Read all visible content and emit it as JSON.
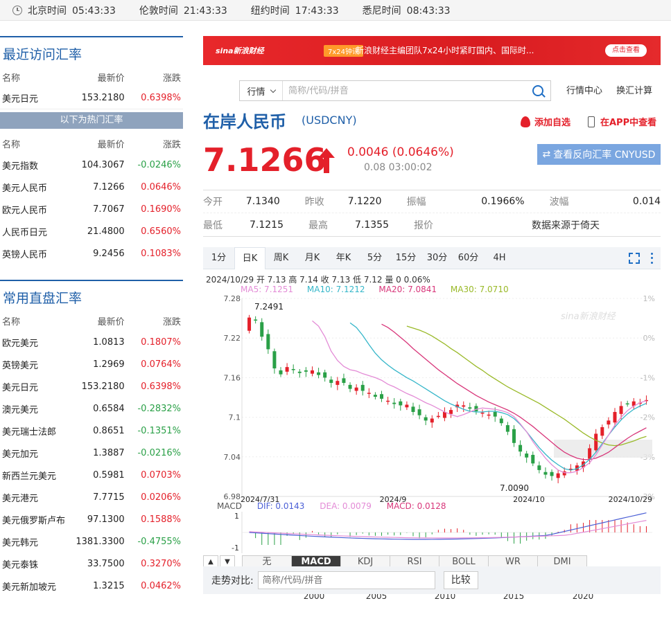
{
  "clock": [
    {
      "city": "北京时间",
      "time": "05:43:33"
    },
    {
      "city": "伦敦时间",
      "time": "21:43:33"
    },
    {
      "city": "纽约时间",
      "time": "17:43:33"
    },
    {
      "city": "悉尼时间",
      "time": "08:43:33"
    }
  ],
  "recent": {
    "title": "最近访问汇率",
    "headers": [
      "名称",
      "最新价",
      "涨跌"
    ],
    "rows": [
      {
        "name": "美元日元",
        "price": "153.2180",
        "chg": "0.6398%",
        "dir": "up"
      }
    ],
    "hot_banner": "以下为热门汇率",
    "hot_headers": [
      "名称",
      "最新价",
      "涨跌"
    ],
    "hot_rows": [
      {
        "name": "美元指数",
        "price": "104.3067",
        "chg": "-0.0246%",
        "dir": "dn"
      },
      {
        "name": "美元人民币",
        "price": "7.1266",
        "chg": "0.0646%",
        "dir": "up"
      },
      {
        "name": "欧元人民币",
        "price": "7.7067",
        "chg": "0.1690%",
        "dir": "up"
      },
      {
        "name": "人民币日元",
        "price": "21.4800",
        "chg": "0.6560%",
        "dir": "up"
      },
      {
        "name": "英镑人民币",
        "price": "9.2456",
        "chg": "0.1083%",
        "dir": "up"
      }
    ]
  },
  "direct": {
    "title": "常用直盘汇率",
    "headers": [
      "名称",
      "最新价",
      "涨跌"
    ],
    "rows": [
      {
        "name": "欧元美元",
        "price": "1.0813",
        "chg": "0.1807%",
        "dir": "up"
      },
      {
        "name": "英镑美元",
        "price": "1.2969",
        "chg": "0.0764%",
        "dir": "up"
      },
      {
        "name": "美元日元",
        "price": "153.2180",
        "chg": "0.6398%",
        "dir": "up"
      },
      {
        "name": "澳元美元",
        "price": "0.6584",
        "chg": "-0.2832%",
        "dir": "dn"
      },
      {
        "name": "美元瑞士法郎",
        "price": "0.8651",
        "chg": "-0.1351%",
        "dir": "dn"
      },
      {
        "name": "美元加元",
        "price": "1.3887",
        "chg": "-0.0216%",
        "dir": "dn"
      },
      {
        "name": "新西兰元美元",
        "price": "0.5981",
        "chg": "0.0703%",
        "dir": "up"
      },
      {
        "name": "美元港元",
        "price": "7.7715",
        "chg": "0.0206%",
        "dir": "up"
      },
      {
        "name": "美元俄罗斯卢布",
        "price": "97.1300",
        "chg": "0.1588%",
        "dir": "up"
      },
      {
        "name": "美元韩元",
        "price": "1381.3300",
        "chg": "-0.4755%",
        "dir": "dn"
      },
      {
        "name": "美元泰铢",
        "price": "33.7500",
        "chg": "0.3270%",
        "dir": "up"
      },
      {
        "name": "美元新加坡元",
        "price": "1.3215",
        "chg": "0.0462%",
        "dir": "up"
      }
    ]
  },
  "ad": {
    "logo": "sina新浪财经",
    "tag": "7x24钟讯",
    "text": "新浪财经主编团队7x24小时紧盯国内、国际时...",
    "button": "点击查看"
  },
  "search": {
    "select": "行情",
    "placeholder": "简称/代码/拼音",
    "link1": "行情中心",
    "link2": "换汇计算"
  },
  "header": {
    "title": "在岸人民币",
    "code": "(USDCNY)",
    "fav": "添加自选",
    "app": "在APP中查看"
  },
  "quote": {
    "price": "7.1266",
    "change": "0.0046 (0.0646%)",
    "time": "0.08 03:00:02",
    "reverse": "查看反向汇率 CNYUSD"
  },
  "stats": {
    "open_l": "今开",
    "open": "7.1340",
    "prev_l": "昨收",
    "prev": "7.1220",
    "amp_l": "振幅",
    "amp": "0.1966%",
    "wave_l": "波幅",
    "wave": "0.014",
    "low_l": "最低",
    "low": "7.1215",
    "high_l": "最高",
    "high": "7.1355",
    "quote_l": "报价",
    "source": "数据来源于倚天"
  },
  "tabs": [
    "1分",
    "日K",
    "周K",
    "月K",
    "年K",
    "5分",
    "15分",
    "30分",
    "60分",
    "4H"
  ],
  "active_tab": 1,
  "ohlc": "2024/10/29 开 7.13 高 7.14 收 7.13 低 7.12 量 0 0.06%",
  "ma": {
    "ma5": "MA5: 7.1251",
    "ma10": "MA10: 7.1212",
    "ma20": "MA20: 7.0841",
    "ma30": "MA30: 7.0710"
  },
  "macd": {
    "label": "MACD",
    "dif": "DIF: 0.0143",
    "dea": "DEA: 0.0079",
    "macd": "MACD: 0.0128",
    "y_top": "1",
    "y_bot": "-1"
  },
  "indicators": [
    "无",
    "MACD",
    "KDJ",
    "RSI",
    "BOLL",
    "WR",
    "DMI"
  ],
  "active_indicator": 1,
  "range_years": [
    "2000",
    "2005",
    "2010",
    "2015",
    "2020"
  ],
  "compare": {
    "label": "走势对比:",
    "placeholder": "简称/代码/拼音",
    "button": "比较"
  },
  "colors": {
    "up": "#e4202a",
    "down": "#2aa047",
    "brand": "#1f5fa8"
  },
  "chart_data": {
    "type": "candlestick",
    "ylim": [
      6.98,
      7.28
    ],
    "y_ticks": [
      "7.28",
      "7.22",
      "7.16",
      "7.1",
      "7.04",
      "6.98"
    ],
    "pct_ticks": [
      "1%",
      "0%",
      "-1%",
      "-2%",
      "-3%",
      "-3%"
    ],
    "x_labels": [
      "2024/7/31",
      "2024/9",
      "2024/10",
      "2024/10/29"
    ],
    "max_label": "7.2491",
    "min_label": "7.0090",
    "close": [
      7.251,
      7.247,
      7.222,
      7.203,
      7.174,
      7.165,
      7.176,
      7.172,
      7.167,
      7.169,
      7.171,
      7.164,
      7.16,
      7.152,
      7.155,
      7.152,
      7.143,
      7.145,
      7.14,
      7.137,
      7.131,
      7.128,
      7.125,
      7.12,
      7.118,
      7.119,
      7.108,
      7.103,
      7.095,
      7.098,
      7.102,
      7.108,
      7.111,
      7.119,
      7.118,
      7.113,
      7.109,
      7.107,
      7.104,
      7.101,
      7.091,
      7.078,
      7.061,
      7.048,
      7.039,
      7.03,
      7.02,
      7.013,
      7.011,
      7.015,
      7.018,
      7.022,
      7.027,
      7.033,
      7.053,
      7.075,
      7.085,
      7.095,
      7.108,
      7.117,
      7.12,
      7.124,
      7.122,
      7.126
    ],
    "ma5": [
      7.246,
      7.238,
      7.222,
      7.2,
      7.186,
      7.177,
      7.172,
      7.17,
      7.166,
      7.163,
      7.16,
      7.156,
      7.15,
      7.146,
      7.141,
      7.136,
      7.132,
      7.127,
      7.122,
      7.118,
      7.113,
      7.108,
      7.104,
      7.101,
      7.104,
      7.108,
      7.112,
      7.114,
      7.113,
      7.112,
      7.11,
      7.107,
      7.101,
      7.09,
      7.078,
      7.063,
      7.05,
      7.038,
      7.028,
      7.02,
      7.016,
      7.016,
      7.018,
      7.024,
      7.031,
      7.043,
      7.058,
      7.073,
      7.088,
      7.1,
      7.11,
      7.117,
      7.122,
      7.125
    ],
    "ma10": [
      7.243,
      7.236,
      7.224,
      7.21,
      7.197,
      7.187,
      7.179,
      7.172,
      7.166,
      7.16,
      7.155,
      7.149,
      7.143,
      7.137,
      7.131,
      7.125,
      7.12,
      7.116,
      7.112,
      7.109,
      7.108,
      7.108,
      7.109,
      7.109,
      7.107,
      7.104,
      7.098,
      7.089,
      7.078,
      7.066,
      7.054,
      7.044,
      7.035,
      7.028,
      7.022,
      7.02,
      7.022,
      7.028,
      7.036,
      7.047,
      7.06,
      7.073,
      7.085,
      7.096,
      7.105,
      7.112,
      7.117,
      7.121
    ],
    "ma20": [
      7.241,
      7.236,
      7.229,
      7.221,
      7.213,
      7.204,
      7.196,
      7.188,
      7.18,
      7.172,
      7.165,
      7.158,
      7.151,
      7.145,
      7.139,
      7.133,
      7.128,
      7.123,
      7.119,
      7.115,
      7.111,
      7.106,
      7.1,
      7.093,
      7.086,
      7.078,
      7.07,
      7.062,
      7.054,
      7.047,
      7.042,
      7.038,
      7.036,
      7.036,
      7.038,
      7.042,
      7.047,
      7.054,
      7.061,
      7.068,
      7.074,
      7.079,
      7.084
    ],
    "ma30": [
      7.238,
      7.235,
      7.232,
      7.228,
      7.223,
      7.217,
      7.211,
      7.204,
      7.198,
      7.191,
      7.184,
      7.177,
      7.171,
      7.164,
      7.158,
      7.152,
      7.146,
      7.141,
      7.136,
      7.131,
      7.126,
      7.121,
      7.115,
      7.109,
      7.103,
      7.097,
      7.09,
      7.083,
      7.076,
      7.07,
      7.065,
      7.061,
      7.058,
      7.057,
      7.058,
      7.061,
      7.064,
      7.068,
      7.071
    ]
  }
}
